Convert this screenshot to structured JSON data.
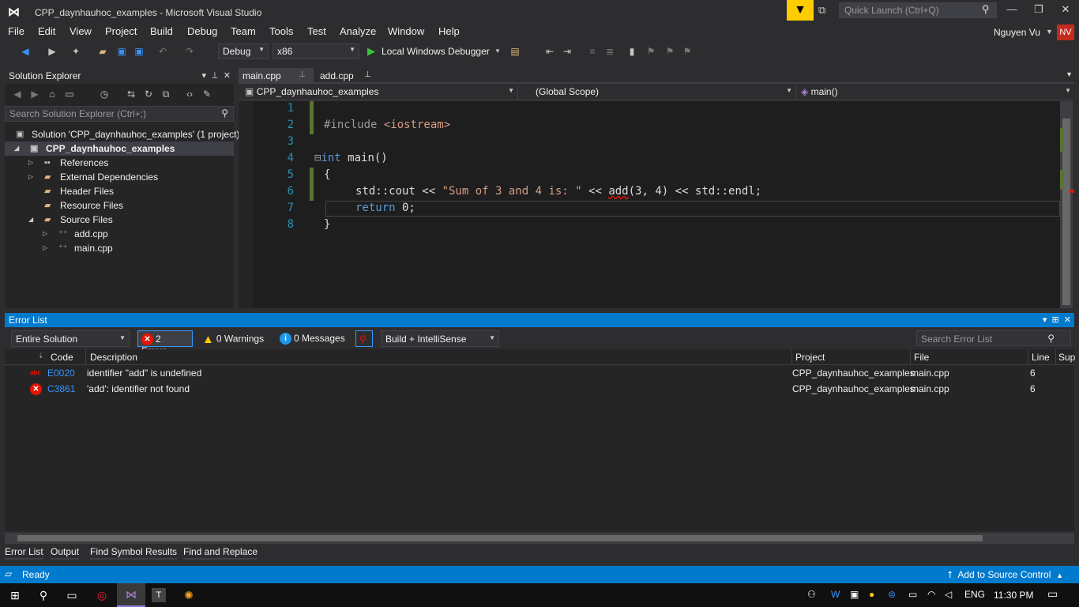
{
  "window": {
    "title": "CPP_daynhauhoc_examples - Microsoft Visual Studio",
    "quick_launch_placeholder": "Quick Launch (Ctrl+Q)",
    "user_name": "Nguyen Vu",
    "avatar_initials": "NV"
  },
  "menu": [
    "File",
    "Edit",
    "View",
    "Project",
    "Build",
    "Debug",
    "Team",
    "Tools",
    "Test",
    "Analyze",
    "Window",
    "Help"
  ],
  "toolbar": {
    "config": "Debug",
    "platform": "x86",
    "debugger": "Local Windows Debugger"
  },
  "solution_explorer": {
    "title": "Solution Explorer",
    "search_placeholder": "Search Solution Explorer (Ctrl+;)",
    "solution": "Solution 'CPP_daynhauhoc_examples' (1 project)",
    "project": "CPP_daynhauhoc_examples",
    "items": [
      "References",
      "External Dependencies",
      "Header Files",
      "Resource Files",
      "Source Files"
    ],
    "source_files": [
      "add.cpp",
      "main.cpp"
    ]
  },
  "editor": {
    "tabs": [
      "main.cpp",
      "add.cpp"
    ],
    "nav_project": "CPP_daynhauhoc_examples",
    "nav_scope": "(Global Scope)",
    "nav_member": "main()",
    "line_numbers": [
      "1",
      "2",
      "3",
      "4",
      "5",
      "6",
      "7",
      "8"
    ],
    "code": {
      "l2_pp": "#include ",
      "l2_str": "<iostream>",
      "l4_kw": "int",
      "l4_rest": " main()",
      "l5": "{",
      "l6_a": "std::cout << ",
      "l6_str": "\"Sum of 3 and 4 is: \"",
      "l6_b": " << ",
      "l6_fn": "add",
      "l6_c": "(3, 4) << std::endl;",
      "l7_kw": "return",
      "l7_rest": " 0;",
      "l8": "}"
    }
  },
  "error_list": {
    "title": "Error List",
    "scope": "Entire Solution",
    "errors_label": "2 Errors",
    "warnings_label": "0 Warnings",
    "messages_label": "0 Messages",
    "build_filter": "Build + IntelliSense",
    "search_placeholder": "Search Error List",
    "columns": [
      "Code",
      "Description",
      "Project",
      "File",
      "Line",
      "Sup"
    ],
    "rows": [
      {
        "code": "E0020",
        "description": "identifier \"add\" is undefined",
        "project": "CPP_daynhauhoc_examples",
        "file": "main.cpp",
        "line": "6"
      },
      {
        "code": "C3861",
        "description": "'add': identifier not found",
        "project": "CPP_daynhauhoc_examples",
        "file": "main.cpp",
        "line": "6"
      }
    ]
  },
  "bottom_tabs": [
    "Error List",
    "Output",
    "Find Symbol Results",
    "Find and Replace"
  ],
  "status": {
    "ready": "Ready",
    "source_control": "Add to Source Control"
  },
  "taskbar": {
    "language": "ENG",
    "time": "11:30 PM"
  },
  "colors": {
    "accent": "#007acc",
    "error": "#e51400",
    "keyword": "#569cd6",
    "string": "#d69d85"
  }
}
